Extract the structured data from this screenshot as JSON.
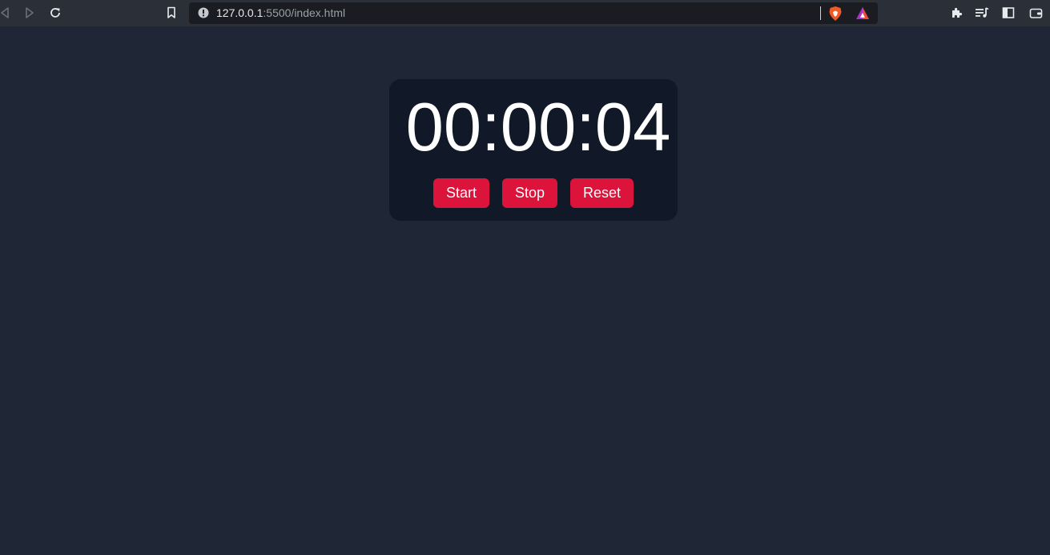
{
  "browser": {
    "url_host": "127.0.0.1",
    "url_rest": ":5500/index.html",
    "icons": {
      "back": "back-icon",
      "forward": "forward-icon",
      "reload": "reload-icon",
      "bookmark": "bookmark-icon",
      "site_info": "info-icon",
      "brave_shield": "brave-shield-icon",
      "brave_rewards": "brave-rewards-icon",
      "extensions": "puzzle-icon",
      "playlist": "playlist-icon",
      "sidebar": "sidebar-icon",
      "wallet": "wallet-icon"
    }
  },
  "stopwatch": {
    "time": "00:00:04",
    "buttons": {
      "start": "Start",
      "stop": "Stop",
      "reset": "Reset"
    }
  },
  "colors": {
    "page_background": "#1f2737",
    "card_background": "#111827",
    "button_accent": "#dc143c",
    "text": "#ffffff"
  }
}
